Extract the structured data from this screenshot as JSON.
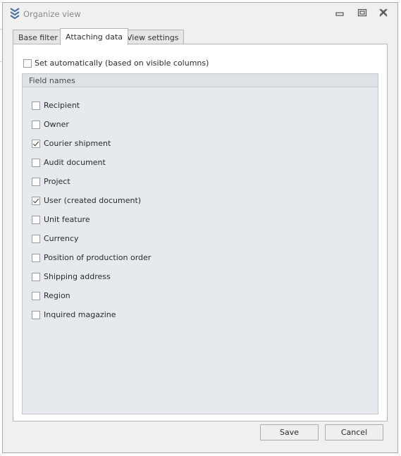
{
  "window": {
    "title": "Organize view"
  },
  "tabs": [
    {
      "label": "Base filter",
      "active": false
    },
    {
      "label": "Attaching data",
      "active": true
    },
    {
      "label": "View settings",
      "active": false
    }
  ],
  "auto_option": {
    "label": "Set automatically (based on visible columns)",
    "checked": false
  },
  "group": {
    "title": "Field names",
    "fields": [
      {
        "label": "Recipient",
        "checked": false
      },
      {
        "label": "Owner",
        "checked": false
      },
      {
        "label": "Courier shipment",
        "checked": true
      },
      {
        "label": "Audit document",
        "checked": false
      },
      {
        "label": "Project",
        "checked": false
      },
      {
        "label": "User (created document)",
        "checked": true
      },
      {
        "label": "Unit feature",
        "checked": false
      },
      {
        "label": "Currency",
        "checked": false
      },
      {
        "label": "Position of production order",
        "checked": false
      },
      {
        "label": "Shipping address",
        "checked": false
      },
      {
        "label": "Region",
        "checked": false
      },
      {
        "label": "Inquired magazine",
        "checked": false
      }
    ]
  },
  "buttons": {
    "save": "Save",
    "cancel": "Cancel"
  },
  "colors": {
    "window_bg": "#f0f0f0",
    "group_bg": "#e6e9ed",
    "icon_blue": "#4a6f9c"
  }
}
